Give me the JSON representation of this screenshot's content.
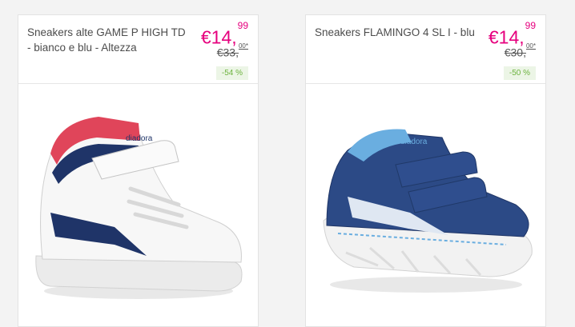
{
  "products": [
    {
      "title": "Sneakers alte GAME P HIGH TD - bianco e blu - Altezza",
      "price_main": "€14,",
      "price_cents": "99",
      "old_price_main": "€33,",
      "old_price_cents": "00*",
      "discount": "-54 %",
      "image_icon": "white-high-top-sneaker-icon",
      "colors": {
        "upper": "#f7f7f7",
        "accent": "#1f3468",
        "collar": "#e0455a"
      }
    },
    {
      "title": "Sneakers FLAMINGO 4 SL I - blu",
      "price_main": "€14,",
      "price_cents": "99",
      "old_price_main": "€30,",
      "old_price_cents": "00*",
      "discount": "-50 %",
      "image_icon": "blue-low-sneaker-icon",
      "colors": {
        "upper": "#2c4a86",
        "accent": "#6aaee0",
        "sole": "#f2f2f2"
      }
    }
  ],
  "colors": {
    "price": "#e6007e",
    "discount_text": "#6cb33e",
    "discount_bg": "#ecf5e6"
  }
}
